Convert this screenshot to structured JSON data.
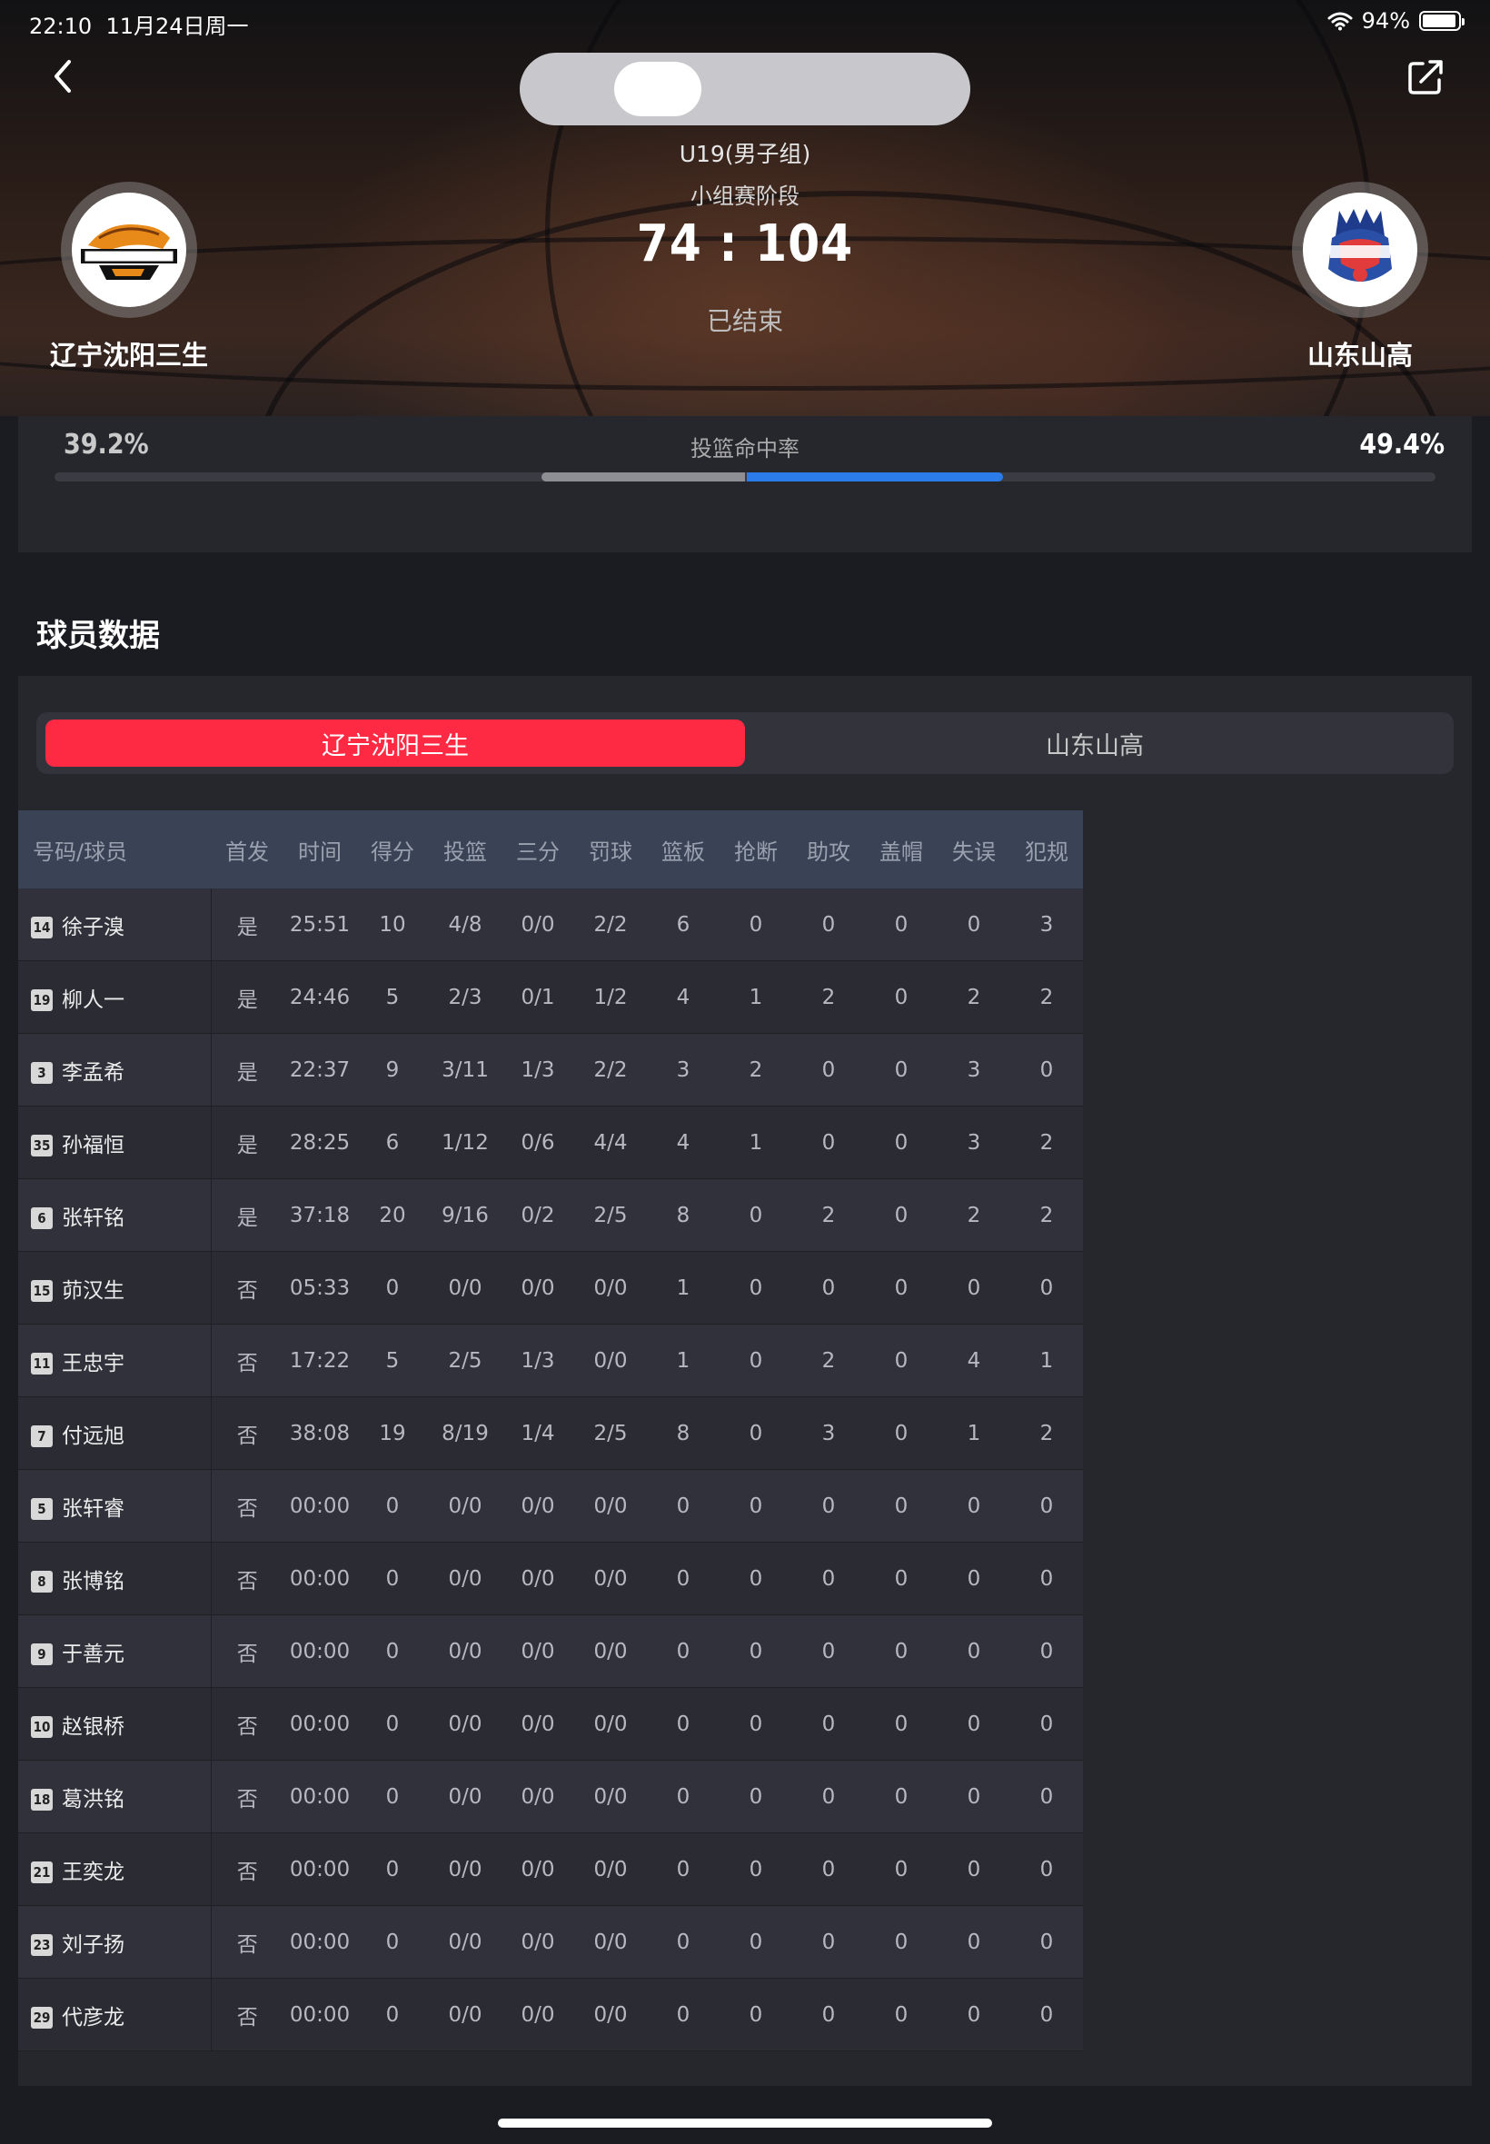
{
  "status_bar": {
    "time": "22:10",
    "date": "11月24日周一",
    "battery": "94%",
    "battery_level": 0.94
  },
  "game": {
    "category": "U19(男子组)",
    "stage": "小组赛阶段",
    "score": "74 : 104",
    "status": "已结束",
    "home_team": "辽宁沈阳三生",
    "away_team": "山东山高"
  },
  "shooting": {
    "label": "投篮命中率",
    "home_pct_text": "39.2%",
    "away_pct_text": "49.4%",
    "home_pct": 39.2,
    "away_pct": 49.4
  },
  "section_title": "球员数据",
  "tabs": {
    "active": "辽宁沈阳三生",
    "inactive": "山东山高"
  },
  "table": {
    "columns": [
      "号码/球员",
      "首发",
      "时间",
      "得分",
      "投篮",
      "三分",
      "罚球",
      "篮板",
      "抢断",
      "助攻",
      "盖帽",
      "失误",
      "犯规"
    ],
    "rows": [
      {
        "num": "14",
        "name": "徐子溴",
        "cells": [
          "是",
          "25:51",
          "10",
          "4/8",
          "0/0",
          "2/2",
          "6",
          "0",
          "0",
          "0",
          "0",
          "3"
        ]
      },
      {
        "num": "19",
        "name": "柳人一",
        "cells": [
          "是",
          "24:46",
          "5",
          "2/3",
          "0/1",
          "1/2",
          "4",
          "1",
          "2",
          "0",
          "2",
          "2"
        ]
      },
      {
        "num": "3",
        "name": "李孟希",
        "cells": [
          "是",
          "22:37",
          "9",
          "3/11",
          "1/3",
          "2/2",
          "3",
          "2",
          "0",
          "0",
          "3",
          "0"
        ]
      },
      {
        "num": "35",
        "name": "孙福恒",
        "cells": [
          "是",
          "28:25",
          "6",
          "1/12",
          "0/6",
          "4/4",
          "4",
          "1",
          "0",
          "0",
          "3",
          "2"
        ]
      },
      {
        "num": "6",
        "name": "张轩铭",
        "cells": [
          "是",
          "37:18",
          "20",
          "9/16",
          "0/2",
          "2/5",
          "8",
          "0",
          "2",
          "0",
          "2",
          "2"
        ]
      },
      {
        "num": "15",
        "name": "茆汉生",
        "cells": [
          "否",
          "05:33",
          "0",
          "0/0",
          "0/0",
          "0/0",
          "1",
          "0",
          "0",
          "0",
          "0",
          "0"
        ]
      },
      {
        "num": "11",
        "name": "王忠宇",
        "cells": [
          "否",
          "17:22",
          "5",
          "2/5",
          "1/3",
          "0/0",
          "1",
          "0",
          "2",
          "0",
          "4",
          "1"
        ]
      },
      {
        "num": "7",
        "name": "付远旭",
        "cells": [
          "否",
          "38:08",
          "19",
          "8/19",
          "1/4",
          "2/5",
          "8",
          "0",
          "3",
          "0",
          "1",
          "2"
        ]
      },
      {
        "num": "5",
        "name": "张轩睿",
        "cells": [
          "否",
          "00:00",
          "0",
          "0/0",
          "0/0",
          "0/0",
          "0",
          "0",
          "0",
          "0",
          "0",
          "0"
        ]
      },
      {
        "num": "8",
        "name": "张博铭",
        "cells": [
          "否",
          "00:00",
          "0",
          "0/0",
          "0/0",
          "0/0",
          "0",
          "0",
          "0",
          "0",
          "0",
          "0"
        ]
      },
      {
        "num": "9",
        "name": "于善元",
        "cells": [
          "否",
          "00:00",
          "0",
          "0/0",
          "0/0",
          "0/0",
          "0",
          "0",
          "0",
          "0",
          "0",
          "0"
        ]
      },
      {
        "num": "10",
        "name": "赵银桥",
        "cells": [
          "否",
          "00:00",
          "0",
          "0/0",
          "0/0",
          "0/0",
          "0",
          "0",
          "0",
          "0",
          "0",
          "0"
        ]
      },
      {
        "num": "18",
        "name": "葛洪铭",
        "cells": [
          "否",
          "00:00",
          "0",
          "0/0",
          "0/0",
          "0/0",
          "0",
          "0",
          "0",
          "0",
          "0",
          "0"
        ]
      },
      {
        "num": "21",
        "name": "王奕龙",
        "cells": [
          "否",
          "00:00",
          "0",
          "0/0",
          "0/0",
          "0/0",
          "0",
          "0",
          "0",
          "0",
          "0",
          "0"
        ]
      },
      {
        "num": "23",
        "name": "刘子扬",
        "cells": [
          "否",
          "00:00",
          "0",
          "0/0",
          "0/0",
          "0/0",
          "0",
          "0",
          "0",
          "0",
          "0",
          "0"
        ]
      },
      {
        "num": "29",
        "name": "代彦龙",
        "cells": [
          "否",
          "00:00",
          "0",
          "0/0",
          "0/0",
          "0/0",
          "0",
          "0",
          "0",
          "0",
          "0",
          "0"
        ]
      }
    ]
  },
  "colors": {
    "accent_red": "#fe2a44",
    "accent_blue": "#2b7bea",
    "panel": "#26272d"
  },
  "icons": {
    "back": "chevron-left-icon",
    "share": "share-icon",
    "wifi": "wifi-icon",
    "battery": "battery-icon"
  }
}
